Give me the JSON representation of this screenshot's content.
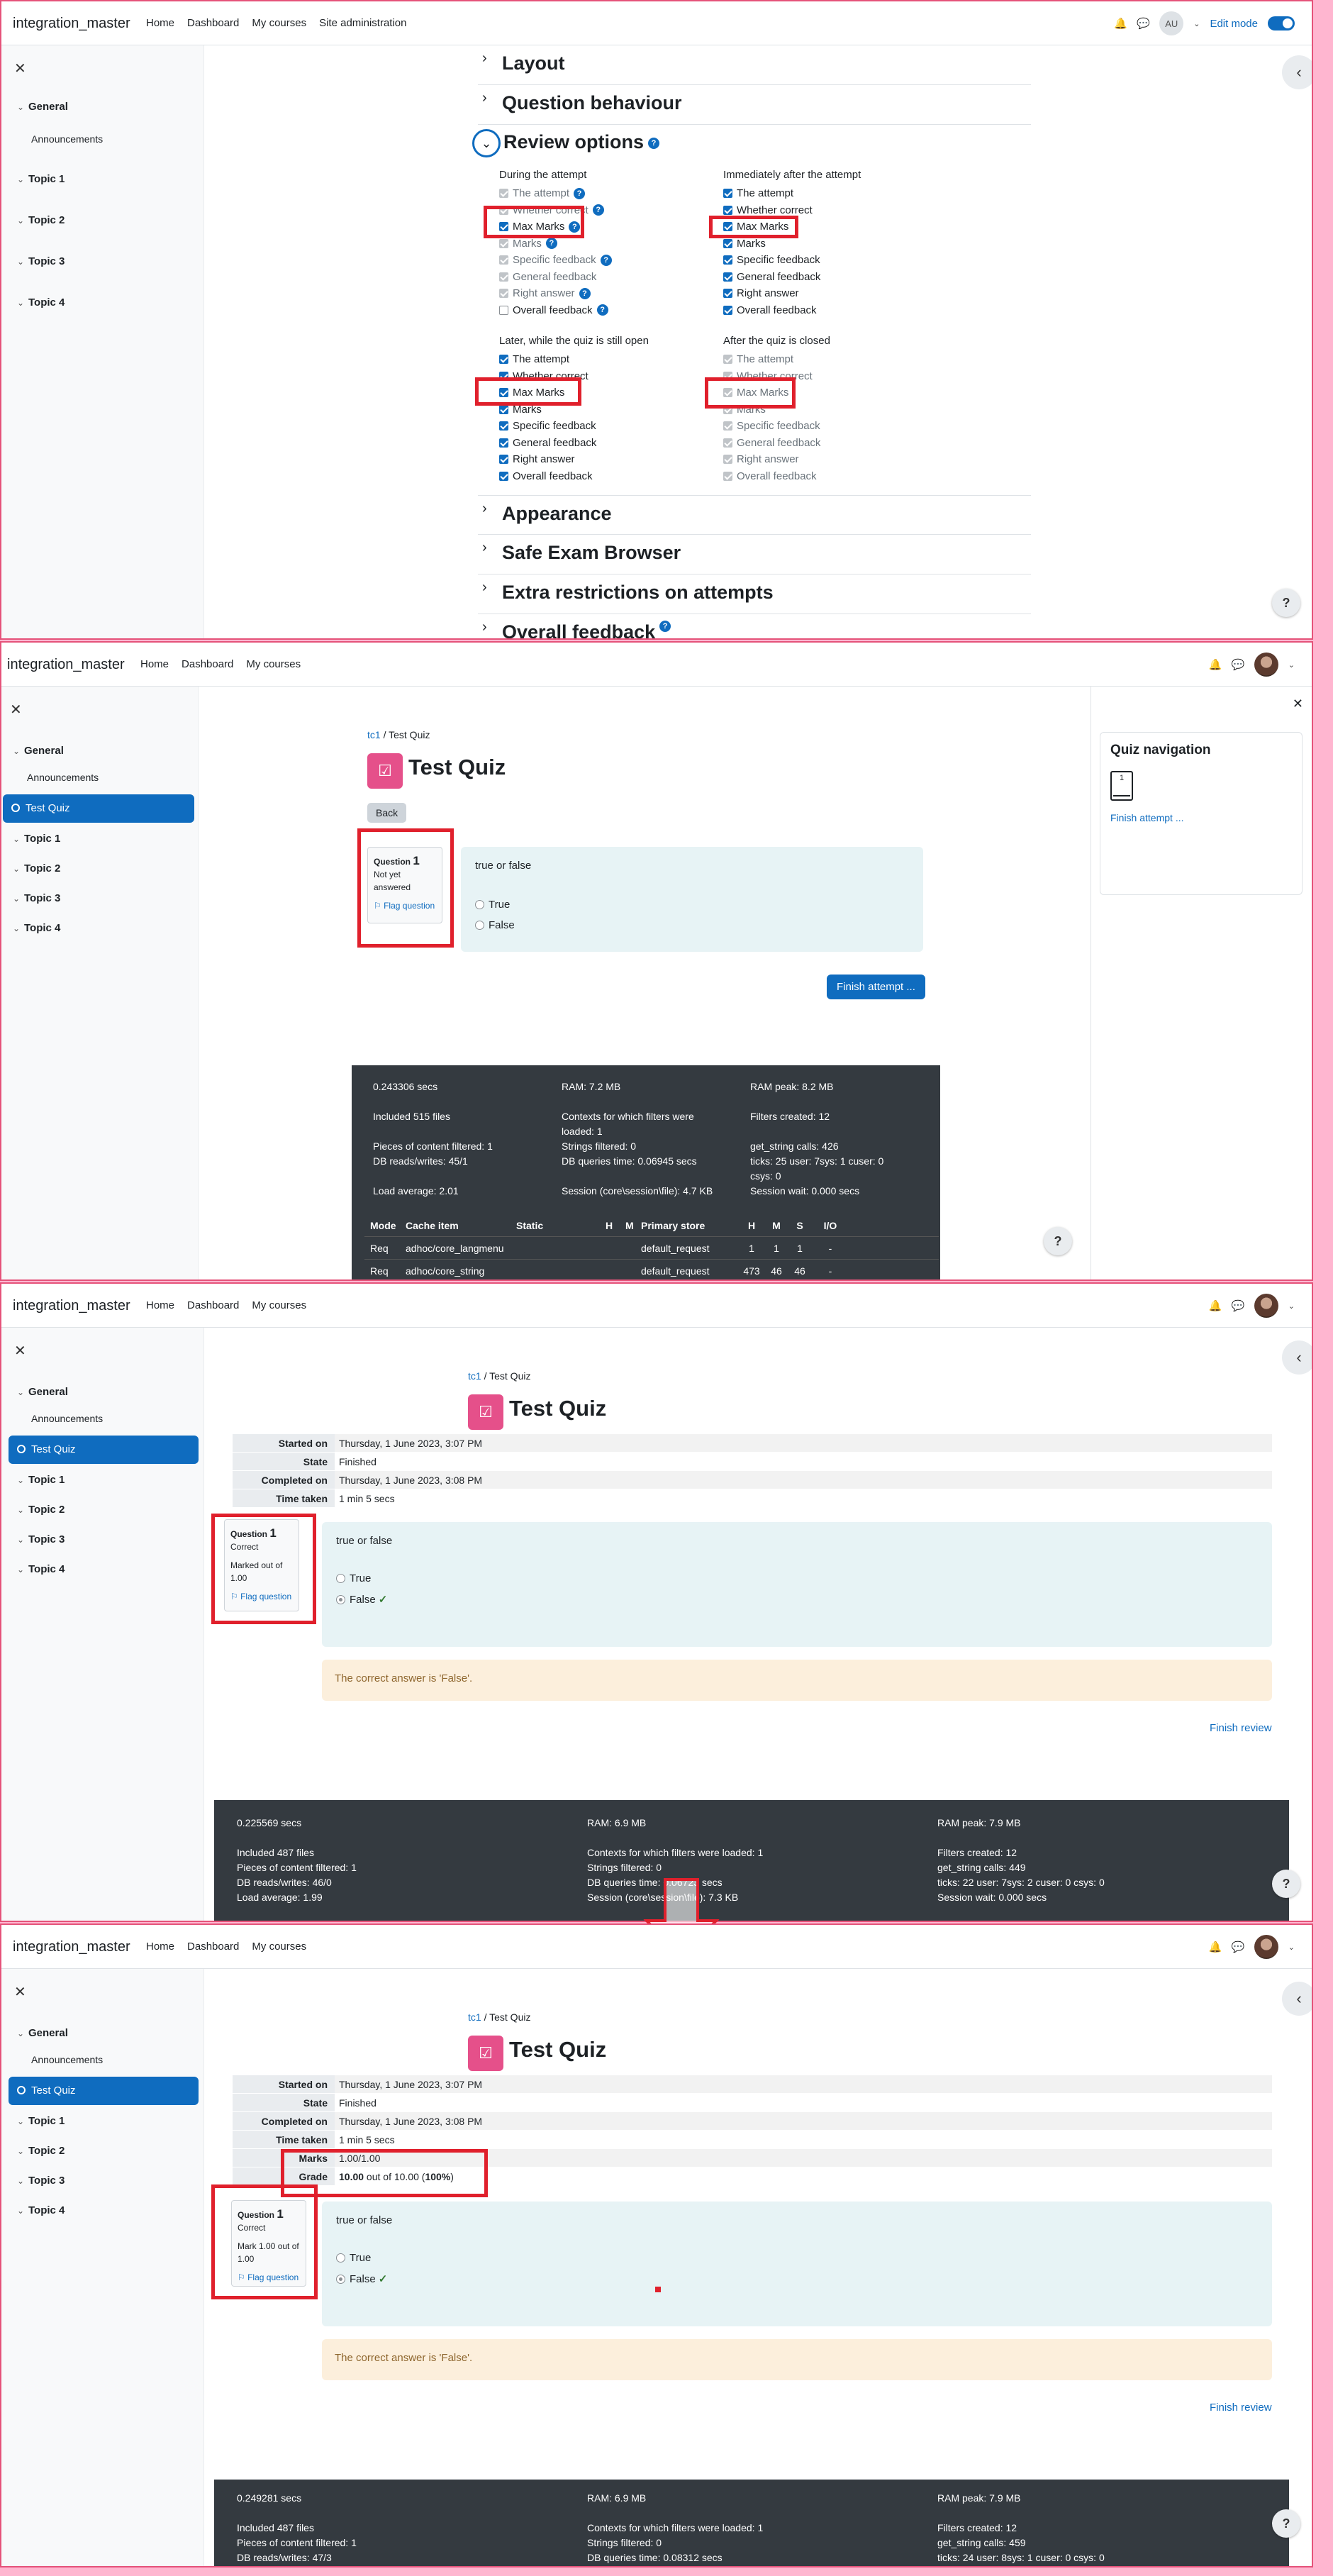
{
  "nav": {
    "brand": "integration_master",
    "home": "Home",
    "dashboard": "Dashboard",
    "mycourses": "My courses",
    "siteadmin": "Site administration",
    "avatar_initials": "AU",
    "edit_mode": "Edit mode"
  },
  "drawer": {
    "general": "General",
    "announcements": "Announcements",
    "test_quiz": "Test Quiz",
    "topics": [
      "Topic 1",
      "Topic 2",
      "Topic 3",
      "Topic 4"
    ]
  },
  "settings": {
    "sections_top": [
      "Layout",
      "Question behaviour"
    ],
    "review_options": "Review options",
    "sections_bottom": [
      "Appearance",
      "Safe Exam Browser",
      "Extra restrictions on attempts",
      "Overall feedback"
    ],
    "groups": [
      {
        "title": "During the attempt",
        "items": [
          "The attempt",
          "Whether correct",
          "Max Marks",
          "Marks",
          "Specific feedback",
          "General feedback",
          "Right answer",
          "Overall feedback"
        ],
        "state": [
          "dis",
          "dis",
          "on",
          "dis",
          "dis",
          "dis",
          "dis",
          "off"
        ]
      },
      {
        "title": "Immediately after the attempt",
        "items": [
          "The attempt",
          "Whether correct",
          "Max Marks",
          "Marks",
          "Specific feedback",
          "General feedback",
          "Right answer",
          "Overall feedback"
        ],
        "state": [
          "on",
          "on",
          "on",
          "on",
          "on",
          "on",
          "on",
          "on"
        ]
      },
      {
        "title": "Later, while the quiz is still open",
        "items": [
          "The attempt",
          "Whether correct",
          "Max Marks",
          "Marks",
          "Specific feedback",
          "General feedback",
          "Right answer",
          "Overall feedback"
        ],
        "state": [
          "on",
          "on",
          "on",
          "on",
          "on",
          "on",
          "on",
          "on"
        ]
      },
      {
        "title": "After the quiz is closed",
        "items": [
          "The attempt",
          "Whether correct",
          "Max Marks",
          "Marks",
          "Specific feedback",
          "General feedback",
          "Right answer",
          "Overall feedback"
        ],
        "state": [
          "dis",
          "dis",
          "dis",
          "dis",
          "dis",
          "dis",
          "dis",
          "dis"
        ]
      }
    ]
  },
  "quiz": {
    "crumb_course": "tc1",
    "crumb_sep": "/",
    "crumb_page": "Test Quiz",
    "title": "Test Quiz",
    "back": "Back",
    "question_label": "Question",
    "question_number": "1",
    "not_yet": "Not yet answered",
    "correct": "Correct",
    "marked_out": "Marked out of 1.00",
    "mark_1_out": "Mark 1.00 out of 1.00",
    "flag": "Flag question",
    "question_text": "true or false",
    "opt_true": "True",
    "opt_false": "False",
    "finish_attempt": "Finish attempt ...",
    "quiz_navigation": "Quiz navigation",
    "nav_q": "1",
    "correct_answer": "The correct answer is 'False'.",
    "finish_review": "Finish review"
  },
  "summary": {
    "rows3": [
      [
        "Started on",
        "Thursday, 1 June 2023, 3:07 PM"
      ],
      [
        "State",
        "Finished"
      ],
      [
        "Completed on",
        "Thursday, 1 June 2023, 3:08 PM"
      ],
      [
        "Time taken",
        "1 min 5 secs"
      ]
    ],
    "marks_k": "Marks",
    "marks_v": "1.00/1.00",
    "grade_k": "Grade",
    "grade_a": "10.00",
    "grade_b": " out of 10.00 (",
    "grade_c": "100%",
    "grade_d": ")"
  },
  "perf2": {
    "c1": [
      "0.243306 secs",
      "",
      "Included 515 files",
      "",
      "Pieces of content filtered: 1",
      "DB reads/writes: 45/1",
      "",
      "Load average: 2.01"
    ],
    "c2": [
      "RAM: 7.2 MB",
      "",
      "Contexts for which filters were",
      "loaded: 1",
      "Strings filtered: 0",
      "DB queries time: 0.06945 secs",
      "",
      "Session (core\\session\\file): 4.7 KB"
    ],
    "c3": [
      "RAM peak: 8.2 MB",
      "",
      "Filters created: 12",
      "",
      "get_string calls: 426",
      "ticks: 25 user: 7sys: 1 cuser: 0",
      "csys: 0",
      "Session wait: 0.000 secs"
    ],
    "table_head": [
      "Mode",
      "Cache item",
      "Static",
      "H",
      "M",
      "Primary store",
      "H",
      "M",
      "S",
      "I/O"
    ],
    "row1": [
      "Req",
      "adhoc/core_langmenu",
      "",
      "",
      "",
      "default_request",
      "1",
      "1",
      "1",
      "-"
    ],
    "row2": [
      "Req",
      "adhoc/core_string",
      "",
      "",
      "",
      "default_request",
      "473",
      "46",
      "46",
      "-"
    ]
  },
  "perf3": {
    "c1": [
      "0.225569 secs",
      "",
      "Included 487 files",
      "Pieces of content filtered: 1",
      "DB reads/writes: 46/0",
      "Load average: 1.99"
    ],
    "c2": [
      "RAM: 6.9 MB",
      "",
      "Contexts for which filters were loaded: 1",
      "Strings filtered: 0",
      "DB queries time: 0.06723 secs",
      "Session (core\\session\\file): 7.3 KB"
    ],
    "c3": [
      "RAM peak: 7.9 MB",
      "",
      "Filters created: 12",
      "get_string calls: 449",
      "ticks: 22 user: 7sys: 2 cuser: 0 csys: 0",
      "Session wait: 0.000 secs"
    ]
  },
  "perf4": {
    "c1": [
      "0.249281 secs",
      "",
      "Included 487 files",
      "Pieces of content filtered: 1",
      "DB reads/writes: 47/3"
    ],
    "c2": [
      "RAM: 6.9 MB",
      "",
      "Contexts for which filters were loaded: 1",
      "Strings filtered: 0",
      "DB queries time: 0.08312 secs"
    ],
    "c3": [
      "RAM peak: 7.9 MB",
      "",
      "Filters created: 12",
      "get_string calls: 459",
      "ticks: 24 user: 8sys: 1 cuser: 0 csys: 0"
    ]
  },
  "icons": {
    "close": "close-icon",
    "bell": "bell-icon",
    "chat": "chat-icon",
    "chevron": "chevron-icon",
    "help": "help-icon"
  },
  "colors": {
    "accent": "#0f6cbf",
    "highlight": "#e0202c",
    "quiz_icon": "#e5508a"
  }
}
